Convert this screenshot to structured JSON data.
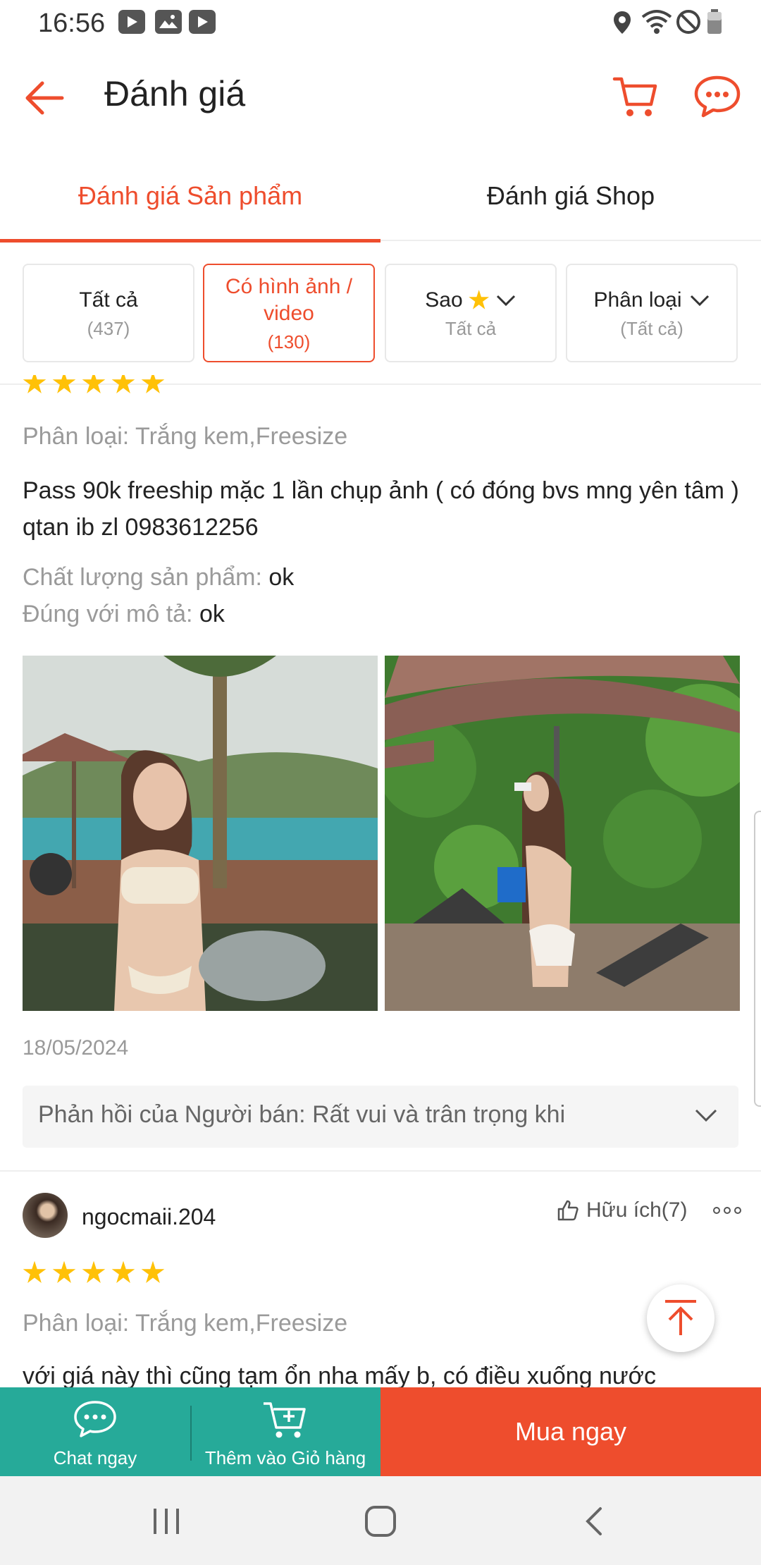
{
  "status": {
    "time": "16:56"
  },
  "header": {
    "title": "Đánh giá"
  },
  "tabs": [
    {
      "label": "Đánh giá Sản phẩm",
      "active": true
    },
    {
      "label": "Đánh giá Shop",
      "active": false
    }
  ],
  "filters": [
    {
      "label": "Tất cả",
      "sub": "(437)",
      "active": false
    },
    {
      "label": "Có hình ảnh / video",
      "sub": "(130)",
      "active": true
    },
    {
      "label": "Sao",
      "sub": "Tất cả",
      "active": false
    },
    {
      "label": "Phân loại",
      "sub": "(Tất cả)",
      "active": false
    }
  ],
  "review1": {
    "variant": "Phân loại: Trắng kem,Freesize",
    "text": "Pass 90k freeship mặc 1 lần chụp ảnh ( có đóng bvs mng yên tâm ) qtan ib zl 0983612256",
    "quality_label": "Chất lượng sản phẩm:",
    "quality_value": "ok",
    "desc_label": "Đúng với mô tả:",
    "desc_value": "ok",
    "date": "18/05/2024",
    "seller_reply": "Phản hồi của Người bán: Rất vui và trân trọng khi"
  },
  "review2": {
    "username": "ngocmaii.204",
    "helpful": "Hữu ích(7)",
    "variant": "Phân loại: Trắng kem,Freesize",
    "text": "với giá này thì cũng tạm ổn nha mấy b, có điều xuống nước"
  },
  "bottom": {
    "chat": "Chat ngay",
    "add_cart": "Thêm vào Giỏ hàng",
    "buy": "Mua ngay"
  },
  "colors": {
    "accent": "#ee4d2d",
    "teal": "#26aa99",
    "star": "#ffc107"
  }
}
